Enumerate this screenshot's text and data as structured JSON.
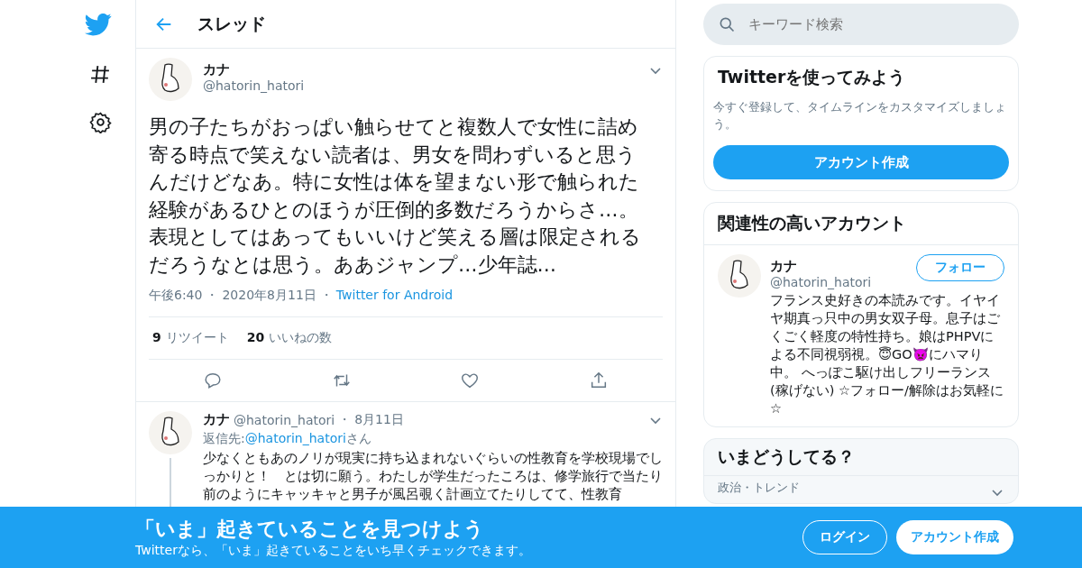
{
  "header": {
    "title": "スレッド"
  },
  "tweet": {
    "name": "カナ",
    "handle": "@hatorin_hatori",
    "text": "男の子たちがおっぱい触らせてと複数人で女性に詰め寄る時点で笑えない読者は、男女を問わずいると思うんだけどなあ。特に女性は体を望まない形で触られた経験があるひとのほうが圧倒的多数だろうからさ…。表現としてはあってもいいけど笑える層は限定されるだろうなとは思う。ああジャンプ…少年誌…",
    "time": "午後6:40",
    "separator": "・",
    "date": "2020年8月11日",
    "source": "Twitter for Android",
    "retweets": "9",
    "retweets_label": "リツイート",
    "likes": "20",
    "likes_label": "いいねの数"
  },
  "reply": {
    "name": "カナ",
    "handle": "@hatorin_hatori",
    "date": "8月11日",
    "separator": "・",
    "reply_to_label": "返信先:",
    "reply_to": "@hatorin_hatori",
    "reply_to_suffix": "さん",
    "text": "少なくともあのノリが現実に持ち込まれないぐらいの性教育を学校現場でしっかりと！　とは切に願う。わたしが学生だったころは、修学旅行で当たり前のようにキャッキャと男子が風呂覗く計画立てたりしてて、性教育"
  },
  "search": {
    "placeholder": "キーワード検索"
  },
  "signup_card": {
    "title": "Twitterを使ってみよう",
    "text": "今すぐ登録して、タイムラインをカスタマイズしましょう。",
    "button": "アカウント作成"
  },
  "related": {
    "title": "関連性の高いアカウント",
    "accounts": [
      {
        "name": "カナ",
        "handle": "@hatorin_hatori",
        "button": "フォロー",
        "bio": "フランス史好きの本読みです。イヤイヤ期真っ只中の男女双子母。息子はごくごく軽度の特性持ち。娘はPHPVによる不同視弱視。😇GO👿にハマり中。 へっぽこ駆け出しフリーランス(稼げない) ☆フォロー/解除はお気軽に☆"
      }
    ]
  },
  "trends": {
    "title": "いまどうしてる？",
    "items": [
      {
        "category": "政治・トレンド"
      }
    ]
  },
  "banner": {
    "title": "「いま」起きていることを見つけよう",
    "subtitle": "Twitterなら、「いま」起きていることをいち早くチェックできます。",
    "login": "ログイン",
    "signup": "アカウント作成"
  }
}
